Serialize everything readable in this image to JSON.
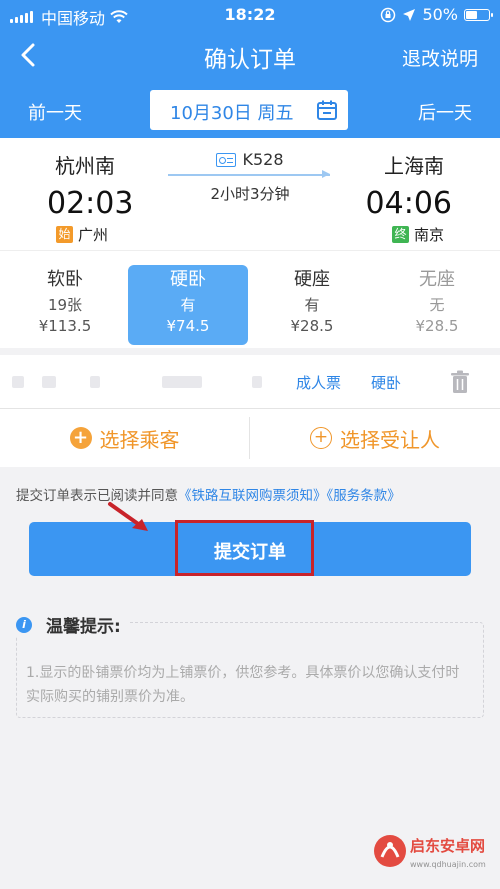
{
  "status_bar": {
    "carrier": "中国移动",
    "time": "18:22",
    "battery": "50%",
    "battery_level": 0.5
  },
  "nav": {
    "title": "确认订单",
    "right_action": "退改说明"
  },
  "date_bar": {
    "prev_day": "前一天",
    "date": "10月30日 周五",
    "next_day": "后一天"
  },
  "train": {
    "number": "K528",
    "duration": "2小时3分钟",
    "departure": {
      "station": "杭州南",
      "time": "02:03",
      "tag": "始",
      "origin": "广州"
    },
    "arrival": {
      "station": "上海南",
      "time": "04:06",
      "tag": "终",
      "terminal": "南京"
    }
  },
  "seats": [
    {
      "name": "软卧",
      "availability": "19张",
      "price": "¥113.5",
      "state": "normal"
    },
    {
      "name": "硬卧",
      "availability": "有",
      "price": "¥74.5",
      "state": "selected"
    },
    {
      "name": "硬座",
      "availability": "有",
      "price": "¥28.5",
      "state": "normal"
    },
    {
      "name": "无座",
      "availability": "无",
      "price": "¥28.5",
      "state": "disabled"
    }
  ],
  "passenger": {
    "ticket_type": "成人票",
    "seat_type": "硬卧"
  },
  "actions": {
    "select_passenger": "选择乘客",
    "select_transferee": "选择受让人"
  },
  "agreement": {
    "prefix": "提交订单表示已阅读并同意",
    "links": "《铁路互联网购票须知》《服务条款》"
  },
  "submit": {
    "label": "提交订单"
  },
  "tips": {
    "title": "温馨提示:",
    "text": "1.显示的卧铺票价均为上铺票价，供您参考。具体票价以您确认支付时实际购买的铺别票价为准。"
  },
  "colors": {
    "primary": "#3b96f2",
    "accent": "#f0962a",
    "highlight": "#c8232a"
  },
  "watermark": {
    "text": "启东安卓网",
    "url": "www.qdhuajin.com"
  }
}
